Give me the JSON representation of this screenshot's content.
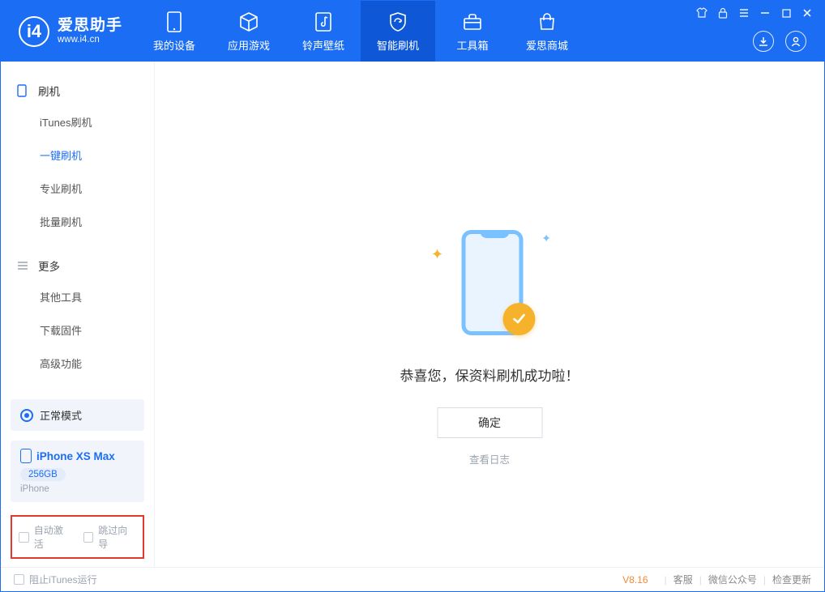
{
  "logo": {
    "title": "爱思助手",
    "subtitle": "www.i4.cn",
    "glyph": "i4"
  },
  "tabs": [
    {
      "label": "我的设备"
    },
    {
      "label": "应用游戏"
    },
    {
      "label": "铃声壁纸"
    },
    {
      "label": "智能刷机"
    },
    {
      "label": "工具箱"
    },
    {
      "label": "爱思商城"
    }
  ],
  "sidebar": {
    "cat1": "刷机",
    "items1": [
      {
        "label": "iTunes刷机"
      },
      {
        "label": "一键刷机"
      },
      {
        "label": "专业刷机"
      },
      {
        "label": "批量刷机"
      }
    ],
    "cat2": "更多",
    "items2": [
      {
        "label": "其他工具"
      },
      {
        "label": "下载固件"
      },
      {
        "label": "高级功能"
      }
    ]
  },
  "mode": {
    "text": "正常模式"
  },
  "device": {
    "name": "iPhone XS Max",
    "capacity": "256GB",
    "type": "iPhone"
  },
  "options": {
    "auto_activate": "自动激活",
    "skip_guide": "跳过向导"
  },
  "main": {
    "success_msg": "恭喜您，保资料刷机成功啦！",
    "ok_btn": "确定",
    "view_log": "查看日志"
  },
  "footer": {
    "block_itunes": "阻止iTunes运行",
    "version": "V8.16",
    "links": [
      "客服",
      "微信公众号",
      "检查更新"
    ]
  }
}
